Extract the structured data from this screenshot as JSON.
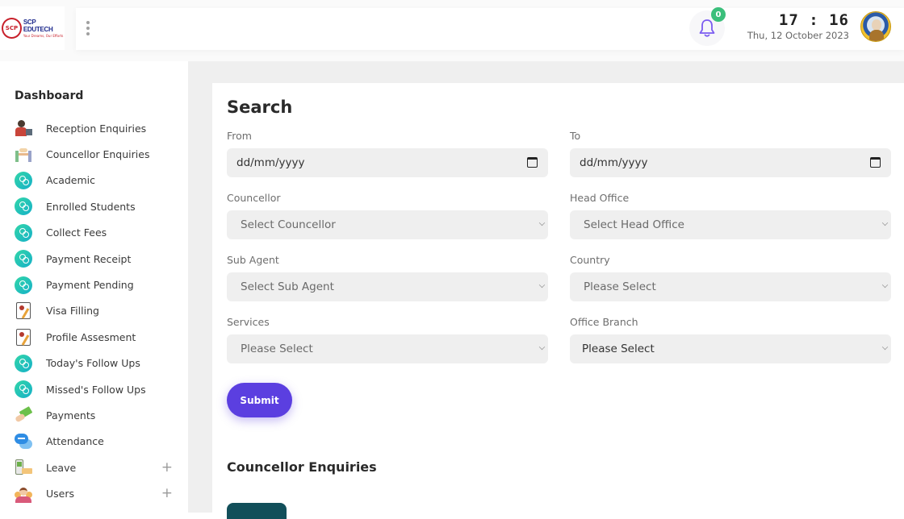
{
  "brand": {
    "logo_mark": "SCP",
    "name": "SCP EDUTECH",
    "tagline": "Your Dreams, Our Efforts"
  },
  "header": {
    "notifications": {
      "icon": "bell-icon",
      "count": "0"
    },
    "time": "17 : 16",
    "date": "Thu, 12 October 2023",
    "avatar": "user-avatar"
  },
  "sidebar": {
    "heading": "Dashboard",
    "items": [
      {
        "label": "Reception Enquiries",
        "icon": "reception-icon"
      },
      {
        "label": "Councellor Enquiries",
        "icon": "meeting-icon"
      },
      {
        "label": "Academic",
        "icon": "link-circle-icon"
      },
      {
        "label": "Enrolled Students",
        "icon": "link-circle-icon"
      },
      {
        "label": "Collect Fees",
        "icon": "link-circle-icon"
      },
      {
        "label": "Payment Receipt",
        "icon": "link-circle-icon"
      },
      {
        "label": "Payment Pending",
        "icon": "link-circle-icon"
      },
      {
        "label": "Visa Filling",
        "icon": "document-pen-icon"
      },
      {
        "label": "Profile Assesment",
        "icon": "document-pen-icon"
      },
      {
        "label": "Today's Follow Ups",
        "icon": "link-circle-icon"
      },
      {
        "label": "Missed's Follow Ups",
        "icon": "link-circle-icon"
      },
      {
        "label": "Payments",
        "icon": "money-hand-icon"
      },
      {
        "label": "Attendance",
        "icon": "chat-bubbles-icon"
      },
      {
        "label": "Leave",
        "icon": "leave-icon",
        "expandable": "+"
      },
      {
        "label": "Users",
        "icon": "users-icon",
        "expandable": "+"
      }
    ]
  },
  "search": {
    "title": "Search",
    "from": {
      "label": "From",
      "placeholder": "dd/mm/yyyy"
    },
    "to": {
      "label": "To",
      "placeholder": "dd/mm/yyyy"
    },
    "councellor": {
      "label": "Councellor",
      "value": "Select Councellor"
    },
    "head_office": {
      "label": "Head Office",
      "value": "Select Head Office"
    },
    "sub_agent": {
      "label": "Sub Agent",
      "value": "Select Sub Agent"
    },
    "country": {
      "label": "Country",
      "value": "Please Select"
    },
    "services": {
      "label": "Services",
      "value": "Please Select"
    },
    "office_branch": {
      "label": "Office Branch",
      "value": "Please Select"
    },
    "submit_label": "Submit"
  },
  "section": {
    "title": "Councellor Enquiries"
  },
  "colors": {
    "primary": "#5b3fe0",
    "badge": "#3bbf7b",
    "teal_button": "#124f5a",
    "bell": "#7b5cf0"
  }
}
